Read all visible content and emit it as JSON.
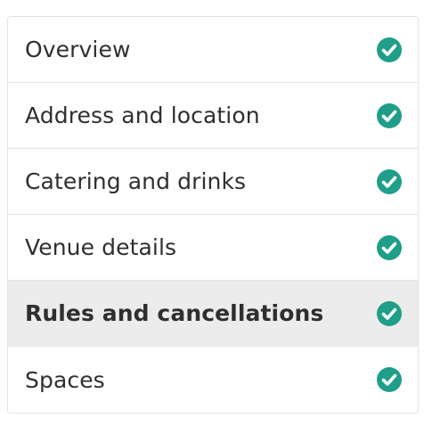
{
  "nav": {
    "accent_color": "#1f9e89",
    "items": [
      {
        "label": "Overview",
        "status_icon": "check-circle-icon",
        "active": false
      },
      {
        "label": "Address and location",
        "status_icon": "check-circle-icon",
        "active": false
      },
      {
        "label": "Catering and drinks",
        "status_icon": "check-circle-icon",
        "active": false
      },
      {
        "label": "Venue details",
        "status_icon": "check-circle-icon",
        "active": false
      },
      {
        "label": "Rules and cancellations",
        "status_icon": "check-circle-icon",
        "active": true
      },
      {
        "label": "Spaces",
        "status_icon": "check-circle-icon",
        "active": false
      }
    ]
  }
}
